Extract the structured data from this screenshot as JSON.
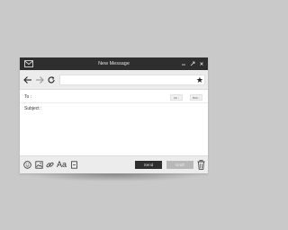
{
  "window": {
    "title": "New Message"
  },
  "toolbar": {
    "back_icon": "arrow-left-icon",
    "forward_icon": "arrow-right-icon",
    "reload_icon": "reload-icon",
    "bookmark_icon": "star-icon"
  },
  "compose": {
    "to_label": "To :",
    "cc_label": "cc :",
    "bcc_label": "bcc :",
    "subject_label": "Subject :"
  },
  "actions": {
    "send_label": "Send",
    "draft_label": "Draft"
  },
  "colors": {
    "background": "#c9c9c9",
    "titlebar": "#2e2e2e",
    "toolbar": "#ececec",
    "send_button": "#2e2e2e",
    "draft_button": "#b8b8b8"
  }
}
